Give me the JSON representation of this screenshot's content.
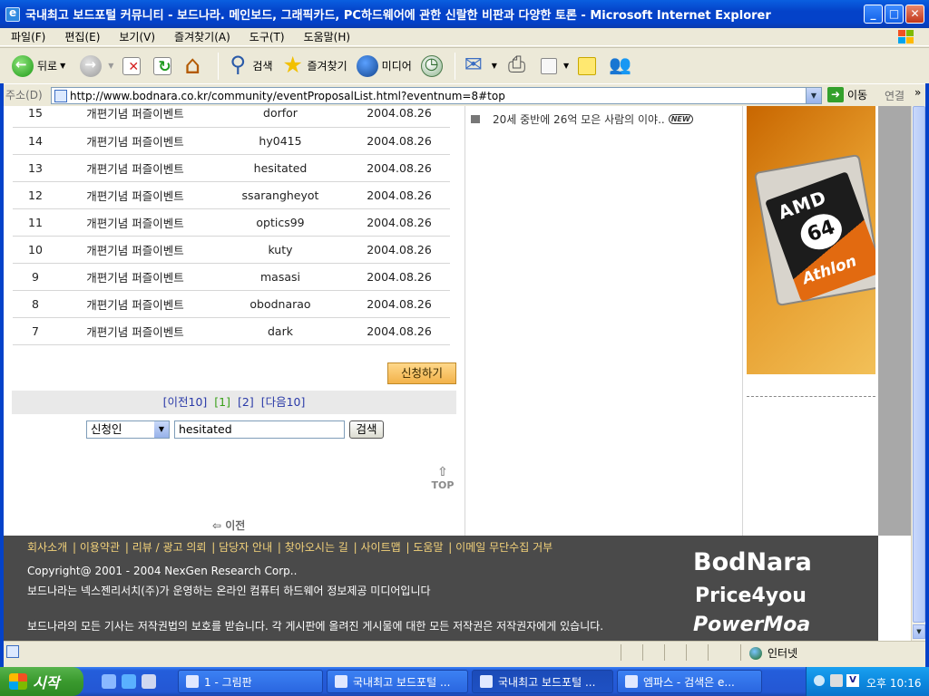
{
  "window": {
    "title": "국내최고 보드포털 커뮤니티 - 보드나라. 메인보드, 그래픽카드, PC하드웨어에 관한 신랄한 비판과 다양한 토론 - Microsoft Internet Explorer",
    "minimize": "_",
    "maximize": "□",
    "close": "✕"
  },
  "menubar": {
    "items": [
      "파일(F)",
      "편집(E)",
      "보기(V)",
      "즐겨찾기(A)",
      "도구(T)",
      "도움말(H)"
    ]
  },
  "toolbar": {
    "back": "뒤로",
    "search": "검색",
    "favorites": "즐겨찾기",
    "media": "미디어"
  },
  "address": {
    "label": "주소(D)",
    "url": "http://www.bodnara.co.kr/community/eventProposalList.html?eventnum=8#top",
    "go": "이동",
    "links": "연결"
  },
  "entries": [
    {
      "num": "15",
      "title": "개편기념 퍼즐이벤트",
      "user": "dorfor",
      "date": "2004.08.26"
    },
    {
      "num": "14",
      "title": "개편기념 퍼즐이벤트",
      "user": "hy0415",
      "date": "2004.08.26"
    },
    {
      "num": "13",
      "title": "개편기념 퍼즐이벤트",
      "user": "hesitated",
      "date": "2004.08.26"
    },
    {
      "num": "12",
      "title": "개편기념 퍼즐이벤트",
      "user": "ssarangheyot",
      "date": "2004.08.26"
    },
    {
      "num": "11",
      "title": "개편기념 퍼즐이벤트",
      "user": "optics99",
      "date": "2004.08.26"
    },
    {
      "num": "10",
      "title": "개편기념 퍼즐이벤트",
      "user": "kuty",
      "date": "2004.08.26"
    },
    {
      "num": "9",
      "title": "개편기념 퍼즐이벤트",
      "user": "masasi",
      "date": "2004.08.26"
    },
    {
      "num": "8",
      "title": "개편기념 퍼즐이벤트",
      "user": "obodnarao",
      "date": "2004.08.26"
    },
    {
      "num": "7",
      "title": "개편기념 퍼즐이벤트",
      "user": "dark",
      "date": "2004.08.26"
    }
  ],
  "apply_button": "신청하기",
  "pager": {
    "prev10": "[이전10]",
    "pages": [
      "[1]",
      "[2]"
    ],
    "current_index": 0,
    "next10": "[다음10]"
  },
  "search": {
    "field_select": "신청인",
    "query": "hesitated",
    "button": "검색"
  },
  "top_link": "TOP",
  "prev_link": "이전",
  "news": {
    "text": "20세 중반에 26억 모은 사람의 이야..",
    "badge": "NEW"
  },
  "ad": {
    "brand": "AMD",
    "bits": "64",
    "product": "Athlon"
  },
  "footer": {
    "links": [
      "회사소개",
      "이용약관",
      "리뷰 / 광고 의뢰",
      "담당자 안내",
      "찾아오시는 길",
      "사이트맵",
      "도움말",
      "이메일 무단수집 거부"
    ],
    "copyright": "Copyright@ 2001 - 2004 NexGen Research Corp..",
    "description": "보드나라는 넥스젠리서치(주)가 운영하는 온라인 컴퓨터 하드웨어 정보제공 미디어입니다",
    "legal": "보드나라의 모든 기사는 저작권법의 보호를 받습니다. 각 게시판에 올려진 게시물에 대한 모든 저작권은 저작권자에게 있습니다.",
    "brands": [
      "BodNara",
      "Price4you",
      "PowerMoa"
    ]
  },
  "status": {
    "zone": "인터넷"
  },
  "taskbar": {
    "start": "시작",
    "tasks": [
      "1 - 그림판",
      "국내최고 보드포털 ...",
      "국내최고 보드포털 ...",
      "엠파스 - 검색은 e..."
    ],
    "active_index": 2,
    "clock": "오후 10:16"
  }
}
